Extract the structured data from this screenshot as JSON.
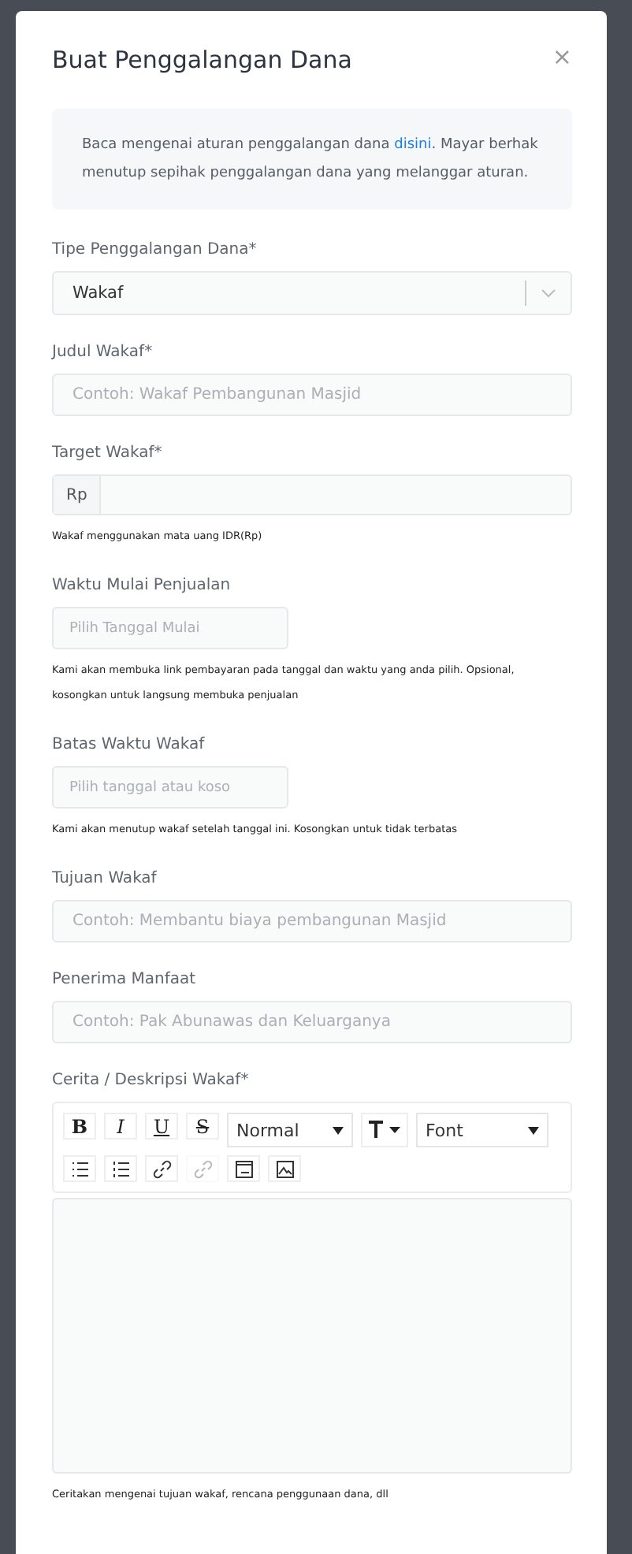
{
  "modal": {
    "title": "Buat Penggalangan Dana",
    "close": "×"
  },
  "notice": {
    "text": "Baca mengenai aturan penggalangan dana ",
    "link": "disini",
    "after": ". Mayar berhak menutup sepihak penggalangan dana yang melanggar aturan."
  },
  "fields": [
    {
      "kind": "select",
      "label": "Tipe Penggalangan Dana*",
      "value": "Wakaf"
    },
    {
      "kind": "text",
      "label": "Judul Wakaf*",
      "placeholder": "Contoh: Wakaf Pembangunan Masjid"
    },
    {
      "kind": "prefix",
      "label": "Target Wakaf*",
      "prefix": "Rp",
      "help": "Wakaf menggunakan mata uang IDR(Rp)"
    },
    {
      "kind": "date",
      "label": "Waktu Mulai Penjualan",
      "placeholder": "Pilih Tanggal Mulai",
      "help": "Kami akan membuka link pembayaran pada tanggal dan waktu yang anda pilih. Opsional, kosongkan untuk langsung membuka penjualan"
    },
    {
      "kind": "date",
      "label": "Batas Waktu Wakaf",
      "placeholder": "Pilih tanggal atau koso",
      "help": "Kami akan menutup wakaf setelah tanggal ini. Kosongkan untuk tidak terbatas"
    },
    {
      "kind": "text",
      "label": "Tujuan Wakaf",
      "placeholder": "Contoh: Membantu biaya pembangunan Masjid"
    },
    {
      "kind": "text",
      "label": "Penerima Manfaat",
      "placeholder": "Contoh: Pak Abunawas dan Keluarganya"
    },
    {
      "kind": "editor",
      "label": "Cerita / Deskripsi Wakaf*",
      "help": "Ceritakan mengenai tujuan wakaf, rencana penggunaan dana, dll"
    }
  ],
  "toolbar": [
    {
      "kind": "bold",
      "text": "B"
    },
    {
      "kind": "italic",
      "text": "I"
    },
    {
      "kind": "underline",
      "text": "U"
    },
    {
      "kind": "strike",
      "text": "S"
    },
    {
      "kind": "dropdown",
      "text": "Normal"
    },
    {
      "kind": "size"
    },
    {
      "kind": "dropdown",
      "text": "Font"
    },
    {
      "kind": "bullet"
    },
    {
      "kind": "ordered"
    },
    {
      "kind": "link",
      "disabled": false
    },
    {
      "kind": "unlink",
      "disabled": true
    },
    {
      "kind": "video"
    },
    {
      "kind": "image"
    }
  ]
}
